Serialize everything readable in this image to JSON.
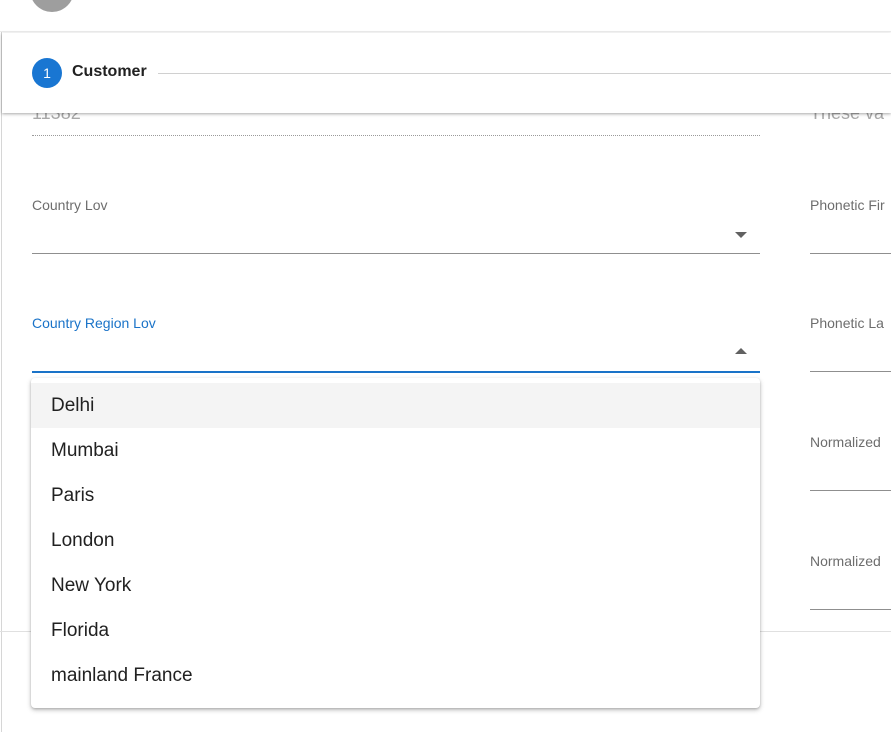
{
  "stepper": {
    "step_number": "1",
    "step_label": "Customer"
  },
  "form": {
    "top_left_value": "11382",
    "top_right_value": "These va",
    "country_lov": {
      "label": "Country Lov",
      "value": ""
    },
    "country_region_lov": {
      "label": "Country Region Lov",
      "value": "",
      "expanded": true
    },
    "phonetic_first": {
      "label": "Phonetic Fir"
    },
    "phonetic_last": {
      "label": "Phonetic La"
    },
    "normalized_1": {
      "label": "Normalized"
    },
    "normalized_2": {
      "label": "Normalized"
    }
  },
  "dropdown": {
    "highlighted_index": 0,
    "options": [
      "Delhi",
      "Mumbai",
      "Paris",
      "London",
      "New York",
      "Florida",
      "mainland France"
    ]
  },
  "colors": {
    "accent": "#1976d2",
    "focus_label": "#1a73c8"
  }
}
